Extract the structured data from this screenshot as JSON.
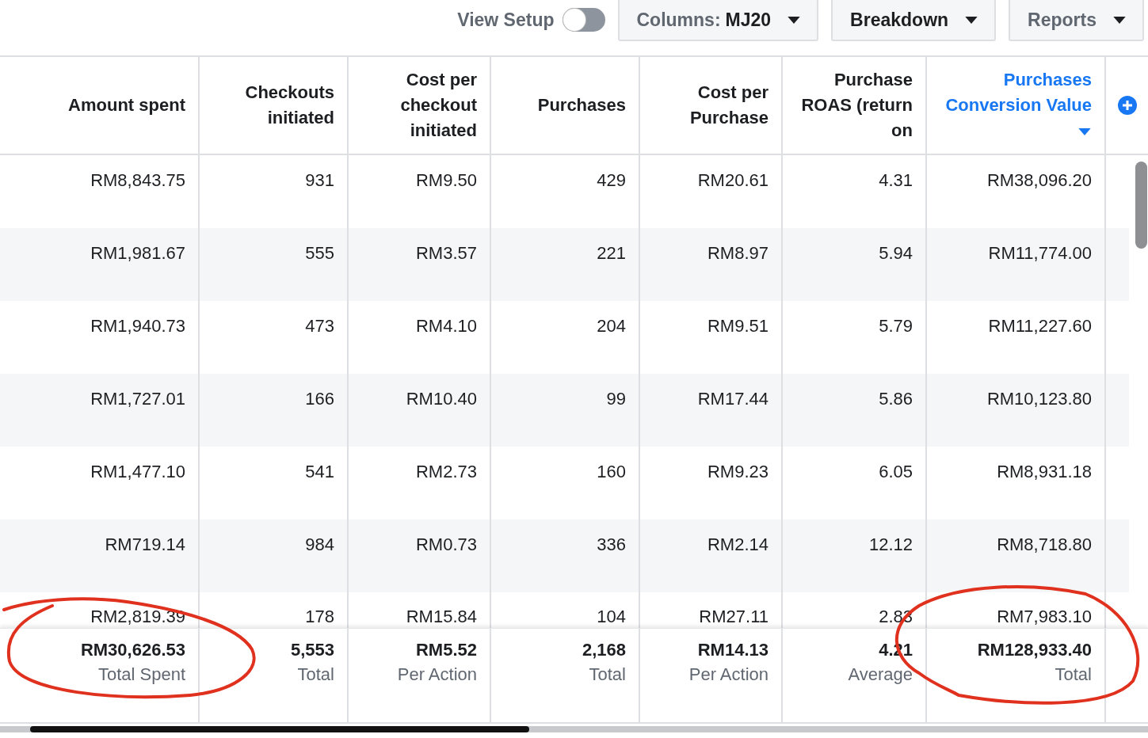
{
  "toolbar": {
    "view_setup": {
      "label": "View Setup",
      "on": false
    },
    "buttons": [
      {
        "label": "Columns:",
        "value": "MJ20",
        "kind": "muted"
      },
      {
        "label": "Breakdown",
        "kind": "strong"
      },
      {
        "label": "Reports",
        "kind": "muted"
      }
    ]
  },
  "table": {
    "columns": [
      {
        "label": "Amount spent",
        "sorted": false
      },
      {
        "label": "Checkouts initiated",
        "sorted": false
      },
      {
        "label": "Cost per checkout initiated",
        "sorted": false
      },
      {
        "label": "Purchases",
        "sorted": false
      },
      {
        "label": "Cost per Purchase",
        "sorted": false
      },
      {
        "label": "Purchase ROAS (return on",
        "sorted": false
      },
      {
        "label": "Purchases Conversion Value",
        "sorted": true
      }
    ],
    "rows": [
      [
        "RM8,843.75",
        "931",
        "RM9.50",
        "429",
        "RM20.61",
        "4.31",
        "RM38,096.20"
      ],
      [
        "RM1,981.67",
        "555",
        "RM3.57",
        "221",
        "RM8.97",
        "5.94",
        "RM11,774.00"
      ],
      [
        "RM1,940.73",
        "473",
        "RM4.10",
        "204",
        "RM9.51",
        "5.79",
        "RM11,227.60"
      ],
      [
        "RM1,727.01",
        "166",
        "RM10.40",
        "99",
        "RM17.44",
        "5.86",
        "RM10,123.80"
      ],
      [
        "RM1,477.10",
        "541",
        "RM2.73",
        "160",
        "RM9.23",
        "6.05",
        "RM8,931.18"
      ],
      [
        "RM719.14",
        "984",
        "RM0.73",
        "336",
        "RM2.14",
        "12.12",
        "RM8,718.80"
      ],
      [
        "RM2,819.39",
        "178",
        "RM15.84",
        "104",
        "RM27.11",
        "2.83",
        "RM7,983.10"
      ]
    ],
    "totals": [
      {
        "value": "RM30,626.53",
        "label": "Total Spent"
      },
      {
        "value": "5,553",
        "label": "Total"
      },
      {
        "value": "RM5.52",
        "label": "Per Action"
      },
      {
        "value": "2,168",
        "label": "Total"
      },
      {
        "value": "RM14.13",
        "label": "Per Action"
      },
      {
        "value": "4.21",
        "label": "Average"
      },
      {
        "value": "RM128,933.40",
        "label": "Total"
      }
    ]
  }
}
